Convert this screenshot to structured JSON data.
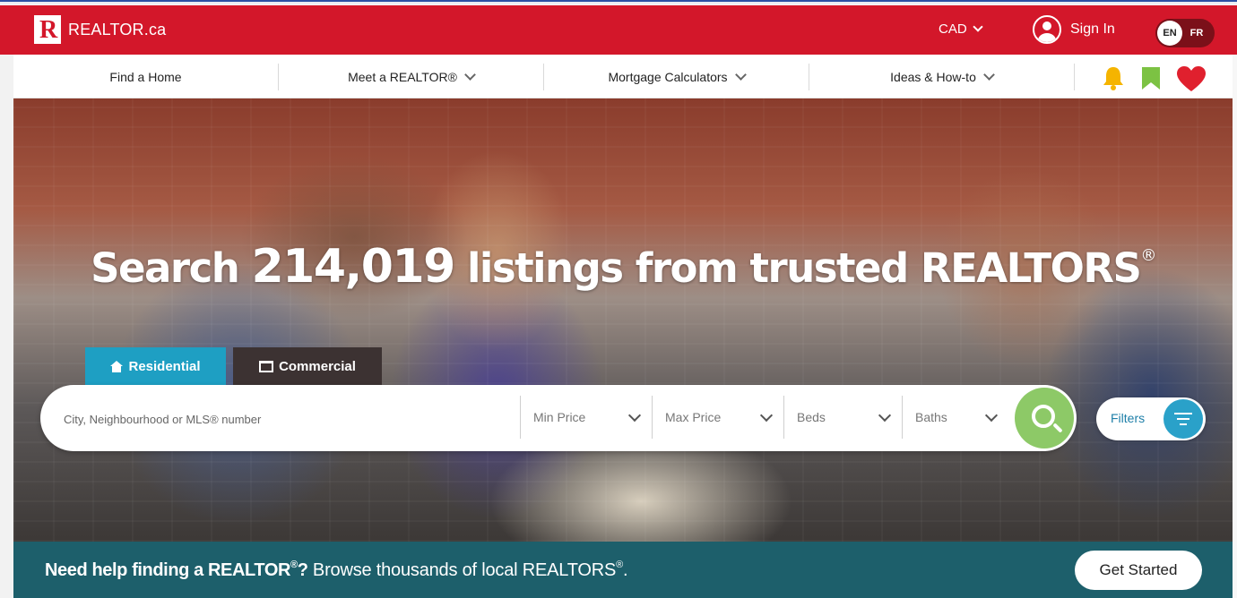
{
  "header": {
    "logo_text": "REALTOR.ca",
    "logo_letter": "R",
    "currency": "CAD",
    "sign_in": "Sign In",
    "lang_active": "EN",
    "lang_other": "FR"
  },
  "nav": {
    "items": [
      {
        "label": "Find a Home"
      },
      {
        "label": "Meet a REALTOR®"
      },
      {
        "label": "Mortgage Calculators"
      },
      {
        "label": "Ideas & How-to"
      }
    ],
    "icons": [
      "bell-icon",
      "bookmark-icon",
      "heart-icon"
    ]
  },
  "hero": {
    "title_prefix": "Search ",
    "listing_count": "214,019",
    "title_suffix": " listings from trusted REALTORS",
    "title_mark": "®"
  },
  "tabs": [
    {
      "label": "Residential",
      "active": true
    },
    {
      "label": "Commercial",
      "active": false
    }
  ],
  "search": {
    "placeholder": "City, Neighbourhood or MLS® number",
    "min_price": "Min Price",
    "max_price": "Max Price",
    "beds": "Beds",
    "baths": "Baths",
    "filters": "Filters"
  },
  "banner": {
    "bold_text": "Need help finding a REALTOR",
    "bold_mark": "®",
    "bold_end": "?",
    "text": " Browse thousands of local REALTORS",
    "text_mark": "®",
    "text_end": ".",
    "button": "Get Started"
  },
  "colors": {
    "brand_red": "#d3172a",
    "residential_tab": "#1e9fc3",
    "search_button": "#8dc967",
    "banner": "#1d5f6b",
    "bell": "#f5b400",
    "bookmark": "#7cc243",
    "heart": "#e0202e"
  }
}
